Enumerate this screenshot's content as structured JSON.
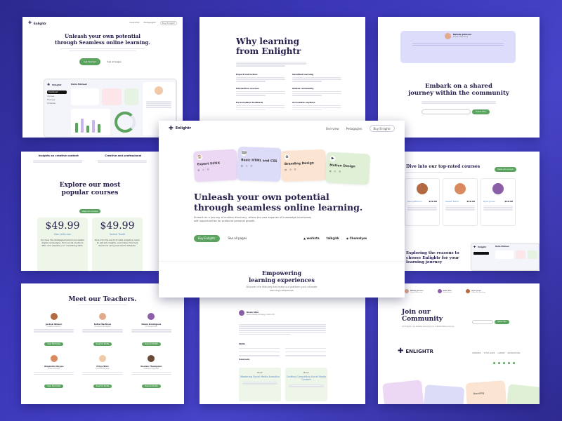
{
  "brand": {
    "name": "Enlightr",
    "footer_name": "ENLIGHTR"
  },
  "colors": {
    "background": "#3b37b8",
    "accent_green": "#5ba45f",
    "heading": "#26214d"
  },
  "nav": {
    "links": [
      "Overview",
      "Pedagogies"
    ],
    "cta": "Buy Enlightr"
  },
  "hero": {
    "title_line1": "Unleash your own potential",
    "title_line2": "through seamless online learning.",
    "subtitle": "Embark on a journey of endless discovery, where the vast expanse of knowledge intertwines with opportunities for profound personal growth.",
    "primary_cta": "Buy Enlightr",
    "secondary_cta": "See all pages",
    "partners": [
      "worksta",
      "talk@hk",
      "Chemalyse"
    ],
    "course_cards": [
      {
        "title": "Expert UI/UX",
        "color": "#ecd8f5"
      },
      {
        "title": "Basic HTML and CSS",
        "color": "#dcdcf8"
      },
      {
        "title": "Branding Design",
        "color": "#fbe4d2"
      },
      {
        "title": "Motion Design",
        "color": "#dff0d6"
      }
    ]
  },
  "empowering": {
    "title_line1": "Empowering",
    "title_line2": "learning experiences",
    "subtitle": "Discover the features that make our platform your ultimate learning companion"
  },
  "top_left": {
    "title_line1": "Unleash your own potential",
    "title_line2": "through Seamless online learning.",
    "primary": "Get Started",
    "secondary": "See all pages",
    "nav": [
      "Overview",
      "Pedagogies",
      "Buy Enlightr"
    ]
  },
  "top_middle": {
    "title_line1": "Why learning",
    "title_line2": "from Enlightr",
    "features": [
      "Expert instruction",
      "Gamified learning",
      "Interactive courses",
      "Global community",
      "Personalized feedback",
      "Accessible anytime"
    ]
  },
  "top_right": {
    "quote_name": "Natalie Johnson",
    "quote_role": "Digital Marketing",
    "title_line1": "Embark on a shared",
    "title_line2": "journey within the community",
    "subscribe": "Subscribe"
  },
  "middle_left": {
    "tabs": [
      "Insights on creative content",
      "Creative and professional"
    ],
    "title_line1": "Explore our most",
    "title_line2": "popular courses",
    "view_all": "View all courses",
    "prices": [
      "$49.99",
      "$49.99"
    ],
    "instructors": [
      "Sian Jefferson",
      "Saeed Tsaldi"
    ],
    "price_descriptions": [
      "Uncover the strategies behind successful digital campaigns, from social media to SEO, and elevate your marketing skills.",
      "Dive into the world of data analytics, learn to extract insights, and make informed decisions using real-world datasets."
    ]
  },
  "middle_right": {
    "title": "Dive into our top-rated courses",
    "view_all": "View all course",
    "reasons_line1": "Exploring the reasons to",
    "reasons_line2": "choose Enlightr for your",
    "reasons_line3": "learning journey",
    "teachers": [
      {
        "name": "Sian Jefferson",
        "price": "$49.99",
        "color": "#f7e7d5"
      },
      {
        "name": "Saeed Tsaldi",
        "price": "$49.99",
        "color": "#fde2dc"
      },
      {
        "name": "Ryan Jones",
        "price": "$49.99",
        "color": "#ebe4f7"
      }
    ]
  },
  "bottom_left": {
    "title": "Meet our Teachers.",
    "teachers": [
      {
        "name": "Jackob Wilson",
        "role": "Creative Director"
      },
      {
        "name": "Sofia Martinez",
        "role": "Business Strategist"
      },
      {
        "name": "Diana Rodriguez",
        "role": "UX Researcher"
      },
      {
        "name": "Alejandro Reyes",
        "role": "Data Scientist"
      },
      {
        "name": "Priya Shin",
        "role": "Product Manager"
      },
      {
        "name": "Declan Thompson",
        "role": "Software Engineer"
      }
    ],
    "button": "View Full Profile"
  },
  "bottom_middle": {
    "author": "Noah Shin",
    "author_role": "Social Media Strategy Instructor",
    "learn_label": "Skills",
    "course_label": "Coursera",
    "cards": [
      {
        "tag": "Book",
        "title": "Mastering Social Media Analytics"
      },
      {
        "tag": "Book",
        "title": "Crafting Compelling Social Media Content"
      }
    ]
  },
  "bottom_right": {
    "title_line1": "Join our",
    "title_line2": "Community",
    "subtitle": "At Enlightr, we believe learning is a collaborative journey.",
    "button": "Subscribe",
    "footer_links": [
      "OVERVIEW",
      "STYLE GUIDE",
      "LICENSE",
      "INSTRUCTIONS"
    ],
    "banner": "Branding"
  },
  "dashboard": {
    "greeting": "Hello Michael",
    "nav_items": [
      "Dashboard",
      "Courses",
      "Message",
      "Schedule"
    ]
  },
  "right_mini_dashboard": {
    "greeting": "Hello Michael",
    "people": [
      {
        "name": "Natalie Johnson",
        "role": "Digital Marketing"
      },
      {
        "name": "Noah Shin",
        "role": "Data Analyst"
      },
      {
        "name": "Ryan Jones",
        "role": "Financial Marketing"
      }
    ]
  }
}
